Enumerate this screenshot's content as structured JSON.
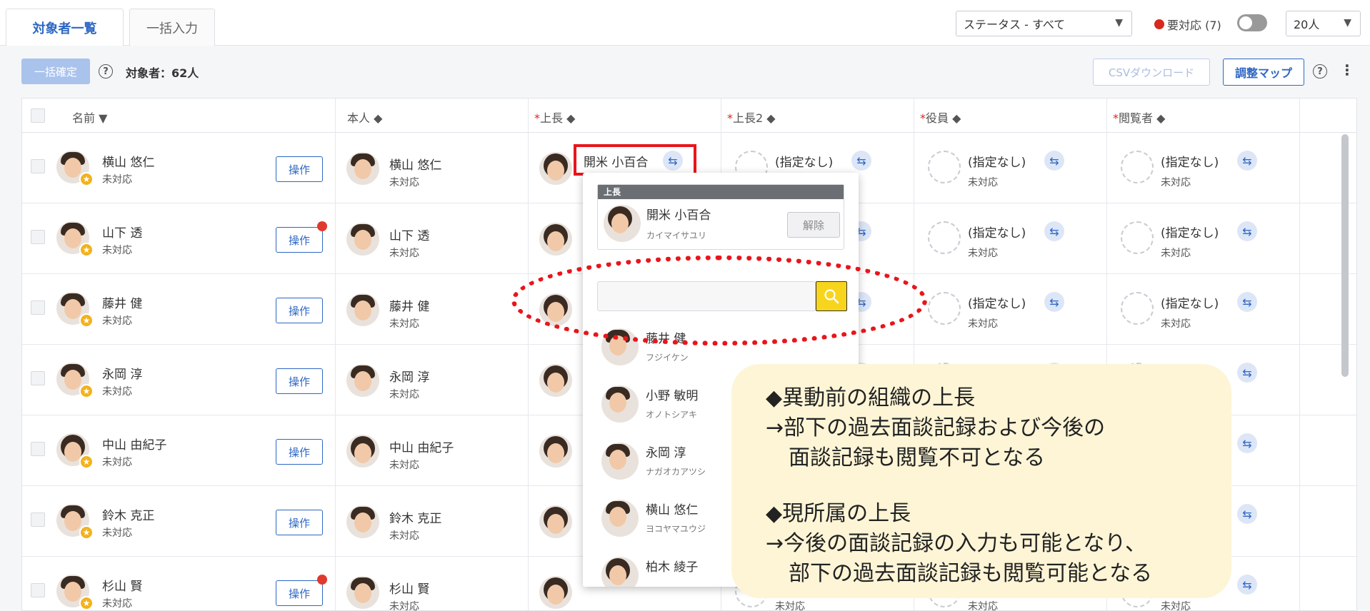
{
  "tabs": {
    "list": "対象者一覧",
    "bulk": "一括入力"
  },
  "filters": {
    "status": "ステータス - すべて",
    "needs_action": "要対応 (7)",
    "page_size": "20人"
  },
  "toolbar": {
    "bulk_confirm": "一括確定",
    "count": "対象者：62人",
    "csv_download": "CSVダウンロード",
    "adjust_map": "調整マップ",
    "help": "?",
    "more": "⋮"
  },
  "columns": {
    "name": "名前 ▼",
    "self": "本人 ◆",
    "boss": "上長 ◆",
    "boss2": "上長2 ◆",
    "exec": "役員 ◆",
    "viewer": "閲覧者 ◆",
    "required_mark": "*"
  },
  "common": {
    "operate": "操作",
    "unanswered": "未対応",
    "none": "(指定なし)",
    "swap_icon": "⇆"
  },
  "rows": [
    {
      "name": "横山 悠仁",
      "status": "未対応",
      "boss": "開米 小百合",
      "notify": false
    },
    {
      "name": "山下 透",
      "status": "未対応",
      "notify": true
    },
    {
      "name": "藤井 健",
      "status": "未対応",
      "notify": false
    },
    {
      "name": "永岡 淳",
      "status": "未対応",
      "notify": false
    },
    {
      "name": "中山 由紀子",
      "status": "未対応",
      "notify": false
    },
    {
      "name": "鈴木 克正",
      "status": "未対応",
      "notify": false
    },
    {
      "name": "杉山 賢",
      "status": "未対応",
      "notify": true
    }
  ],
  "popup": {
    "header": "上長",
    "current_name": "開米 小百合",
    "current_kana": "カイマイサユリ",
    "release": "解除",
    "candidates": [
      {
        "name": "藤井 健",
        "kana": "フジイケン"
      },
      {
        "name": "小野 敏明",
        "kana": "オノトシアキ"
      },
      {
        "name": "永岡 淳",
        "kana": "ナガオカアツシ"
      },
      {
        "name": "横山 悠仁",
        "kana": "ヨコヤマユウジ"
      },
      {
        "name": "柏木 綾子",
        "kana": ""
      }
    ]
  },
  "callout": {
    "line1": "◆異動前の組織の上長",
    "line2": "→部下の過去面談記録および今後の",
    "line3": "面談記録も閲覧不可となる",
    "line4": "◆現所属の上長",
    "line5": "→今後の面談記録の入力も可能となり、",
    "line6": "部下の過去面談記録も閲覧可能となる"
  },
  "colors": {
    "accent": "#2d67c4",
    "highlight": "#e8151b",
    "callout_bg": "#fdf5d6",
    "search_btn": "#f7d51c"
  }
}
